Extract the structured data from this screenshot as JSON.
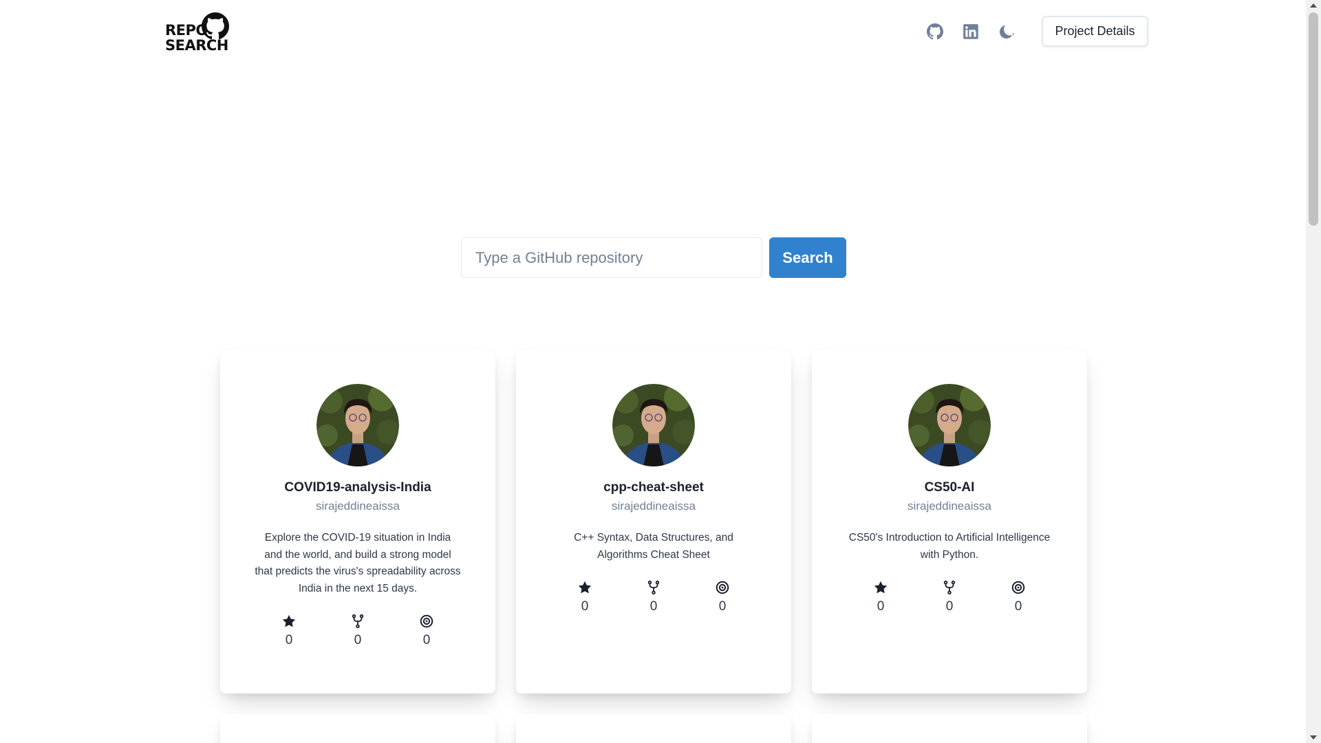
{
  "logo": {
    "line1": "REPO",
    "line2": "SEARCH",
    "icon": "github-octocat-icon"
  },
  "header": {
    "icons": [
      "github-icon",
      "linkedin-icon",
      "moon-icon"
    ],
    "project_button": "Project Details"
  },
  "search": {
    "placeholder": "Type a GitHub repository",
    "value": "",
    "button_label": "Search"
  },
  "cards": [
    {
      "name": "COVID19-analysis-India",
      "owner": "sirajeddineaissa",
      "description": "Explore the COVID-19 situation in India and the world, and build a strong model that predicts the virus's spreadability across India in the next 15 days.",
      "stars": "0",
      "forks": "0",
      "watchers": "0"
    },
    {
      "name": "cpp-cheat-sheet",
      "owner": "sirajeddineaissa",
      "description": "C++ Syntax, Data Structures, and Algorithms Cheat Sheet",
      "stars": "0",
      "forks": "0",
      "watchers": "0"
    },
    {
      "name": "CS50-AI",
      "owner": "sirajeddineaissa",
      "description": "CS50's Introduction to Artificial Intelligence with Python.",
      "stars": "0",
      "forks": "0",
      "watchers": "0"
    }
  ],
  "colors": {
    "accent": "#3182ce",
    "muted": "#718096",
    "text": "#1a202c"
  }
}
